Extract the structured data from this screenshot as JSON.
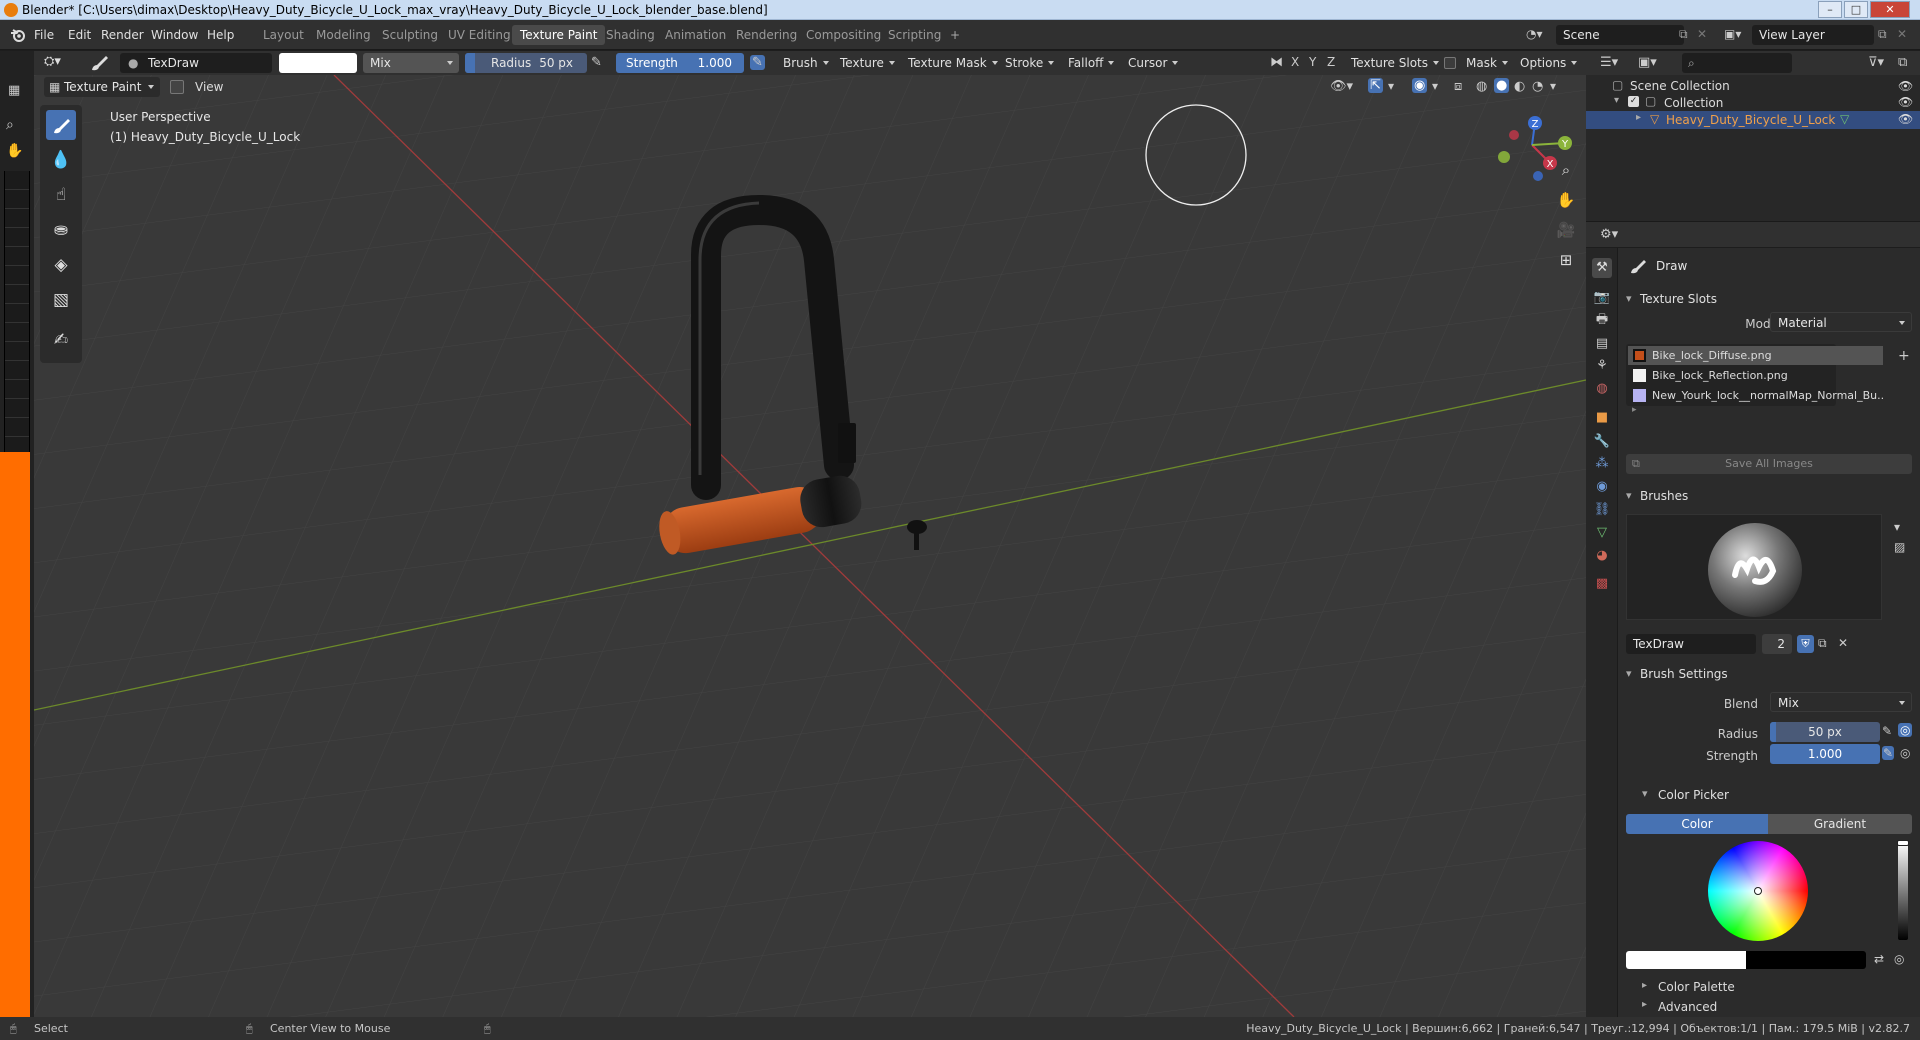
{
  "window": {
    "title": "Blender* [C:\\Users\\dimax\\Desktop\\Heavy_Duty_Bicycle_U_Lock_max_vray\\Heavy_Duty_Bicycle_U_Lock_blender_base.blend]",
    "minimize": "–",
    "maximize": "□",
    "close": "✕"
  },
  "menu": {
    "items": [
      "File",
      "Edit",
      "Render",
      "Window",
      "Help"
    ]
  },
  "workspaces": {
    "tabs": [
      "Layout",
      "Modeling",
      "Sculpting",
      "UV Editing",
      "Texture Paint",
      "Shading",
      "Animation",
      "Rendering",
      "Compositing",
      "Scripting"
    ],
    "active": "Texture Paint",
    "add": "+"
  },
  "scene": {
    "name": "Scene",
    "view_layer": "View Layer"
  },
  "toolheader": {
    "brush_name": "TexDraw",
    "blend": "Mix",
    "radius_label": "Radius",
    "radius_value": "50 px",
    "strength_label": "Strength",
    "strength_value": "1.000",
    "menus": [
      "Brush",
      "Texture",
      "Texture Mask",
      "Stroke",
      "Falloff",
      "Cursor"
    ],
    "axes": [
      "X",
      "Y",
      "Z"
    ],
    "texture_slots": "Texture Slots",
    "mask": "Mask",
    "options": "Options"
  },
  "mode_header": {
    "mode": "Texture Paint",
    "view": "View"
  },
  "viewport": {
    "perspective": "User Perspective",
    "object_label": "(1) Heavy_Duty_Bicycle_U_Lock",
    "gizmo": {
      "x": "X",
      "y": "Y",
      "z": "Z"
    }
  },
  "outliner": {
    "scene_collection": "Scene Collection",
    "collection": "Collection",
    "object": "Heavy_Duty_Bicycle_U_Lock"
  },
  "properties": {
    "tool_name": "Draw",
    "texture_slots": {
      "title": "Texture Slots",
      "mode_label": "Mode",
      "mode_value": "Material",
      "slots": [
        {
          "name": "Bike_lock_Diffuse.png",
          "color": "#c44f1a"
        },
        {
          "name": "Bike_lock_Reflection.png",
          "color": "#f2f2f2"
        },
        {
          "name": "New_Yourk_lock__normalMap_Normal_Bu..",
          "color": "#b7b3f2"
        }
      ],
      "save_all": "Save All Images"
    },
    "brushes": {
      "title": "Brushes",
      "name": "TexDraw",
      "users": "2"
    },
    "brush_settings": {
      "title": "Brush Settings",
      "blend_label": "Blend",
      "blend_value": "Mix",
      "radius_label": "Radius",
      "radius_value": "50 px",
      "strength_label": "Strength",
      "strength_value": "1.000"
    },
    "color_picker": {
      "title": "Color Picker",
      "tab_color": "Color",
      "tab_gradient": "Gradient",
      "color": "#ffffff",
      "secondary": "#000000"
    },
    "color_palette": "Color Palette",
    "advanced": "Advanced"
  },
  "status": {
    "select": "Select",
    "center_view": "Center View to Mouse",
    "info": "Heavy_Duty_Bicycle_U_Lock | Вершин:6,662 | Граней:6,547 | Треуг.:12,994 | Объектов:1/1 | Пам.: 179.5 MiB | v2.82.7"
  },
  "colors": {
    "accent": "#4772b3",
    "header": "#303030",
    "viewport_bg": "#393939",
    "orange_strip": "#ff6d00",
    "lock_orange": "#c4561f"
  }
}
